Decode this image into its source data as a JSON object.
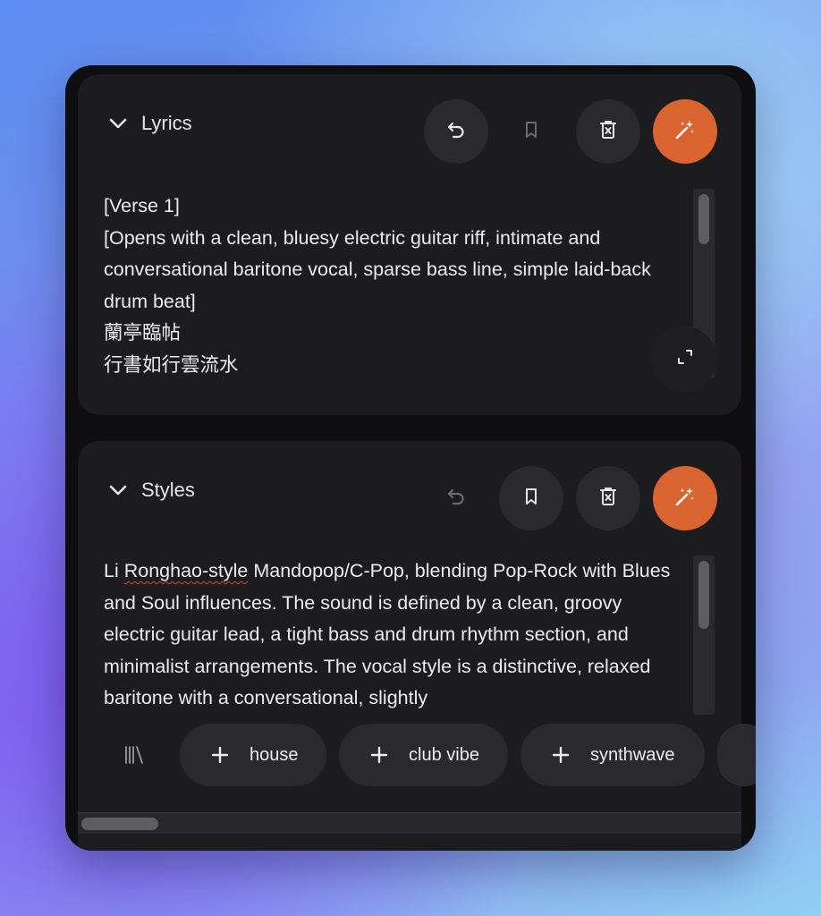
{
  "lyrics": {
    "title": "Lyrics",
    "text": "[Verse 1]\n[Opens with a clean, bluesy electric guitar riff, intimate and conversational baritone vocal, sparse bass line, simple laid-back drum beat]\n蘭亭臨帖\n行書如行雲流水",
    "buttons": [
      "undo-icon",
      "bookmark-icon",
      "delete-icon",
      "magic-wand-icon",
      "expand-icon"
    ]
  },
  "styles": {
    "title": "Styles",
    "text_first_word": "Li ",
    "text_flagged_word": "Ronghao-style",
    "text_rest": " Mandopop/C-Pop, blending Pop-Rock with Blues and Soul influences. The sound is defined by a clean, groovy electric guitar lead, a tight bass and drum rhythm section, and minimalist arrangements. The vocal style is a distinctive, relaxed baritone with a conversational, slightly",
    "buttons": [
      "undo-icon",
      "bookmark-icon",
      "delete-icon",
      "magic-wand-icon"
    ],
    "tags": [
      {
        "label": "house"
      },
      {
        "label": "club vibe"
      },
      {
        "label": "synthwave"
      }
    ]
  },
  "colors": {
    "accent": "#d9642f",
    "panel": "#1c1c1e",
    "button": "#2a2a2d",
    "text": "#ececee"
  }
}
